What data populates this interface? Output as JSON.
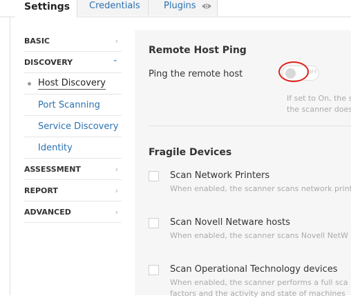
{
  "tabs": {
    "settings": "Settings",
    "credentials": "Credentials",
    "plugins": "Plugins"
  },
  "sidebar": {
    "basic": "BASIC",
    "discovery": "DISCOVERY",
    "sub": {
      "host_discovery": "Host Discovery",
      "port_scanning": "Port Scanning",
      "service_discovery": "Service Discovery",
      "identity": "Identity"
    },
    "assessment": "ASSESSMENT",
    "report": "REPORT",
    "advanced": "ADVANCED"
  },
  "main": {
    "remote_host_ping": {
      "title": "Remote Host Ping",
      "label": "Ping the remote host",
      "toggle_state": "OFF",
      "help_line1": "If set to On, the s",
      "help_line2": "the scanner does"
    },
    "fragile_devices": {
      "title": "Fragile Devices",
      "items": [
        {
          "label": "Scan Network Printers",
          "desc": "When enabled, the scanner scans network print",
          "checked": false
        },
        {
          "label": "Scan Novell Netware hosts",
          "desc": "When enabled, the scanner scans Novell NetW",
          "checked": false
        },
        {
          "label": "Scan Operational Technology devices",
          "desc": "When enabled, the scanner performs a full sca",
          "desc2": "factors and the activity and state of machines",
          "checked": false
        }
      ]
    }
  },
  "colors": {
    "link": "#2b71b1",
    "highlight_circle": "#e0201b"
  }
}
